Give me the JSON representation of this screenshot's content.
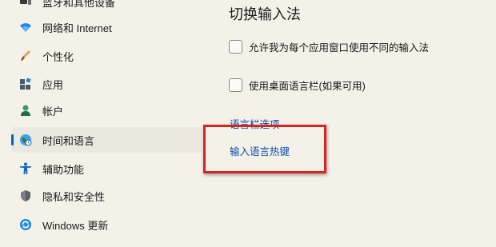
{
  "sidebar": {
    "items": [
      {
        "id": "bluetooth",
        "label": "蓝牙和其他设备",
        "icon": "bluetooth-devices-icon",
        "active": false
      },
      {
        "id": "network",
        "label": "网络和 Internet",
        "icon": "wifi-icon",
        "active": false
      },
      {
        "id": "personalization",
        "label": "个性化",
        "icon": "brush-icon",
        "active": false
      },
      {
        "id": "apps",
        "label": "应用",
        "icon": "apps-icon",
        "active": false
      },
      {
        "id": "accounts",
        "label": "帐户",
        "icon": "account-icon",
        "active": false
      },
      {
        "id": "time-language",
        "label": "时间和语言",
        "icon": "globe-clock-icon",
        "active": true
      },
      {
        "id": "accessibility",
        "label": "辅助功能",
        "icon": "accessibility-icon",
        "active": false
      },
      {
        "id": "privacy",
        "label": "隐私和安全性",
        "icon": "shield-icon",
        "active": false
      },
      {
        "id": "windows-update",
        "label": "Windows 更新",
        "icon": "update-icon",
        "active": false
      }
    ]
  },
  "main": {
    "section_title": "切换输入法",
    "checkboxes": [
      {
        "label": "允许我为每个应用窗口使用不同的输入法",
        "checked": false
      },
      {
        "label": "使用桌面语言栏(如果可用)",
        "checked": false
      }
    ],
    "links": [
      {
        "label": "语言栏选项"
      },
      {
        "label": "输入语言热键",
        "highlighted": true
      }
    ]
  },
  "colors": {
    "background": "#f4f1e8",
    "accent": "#0067c0",
    "link": "#0a4fa8",
    "highlight_border": "#d9231f"
  }
}
